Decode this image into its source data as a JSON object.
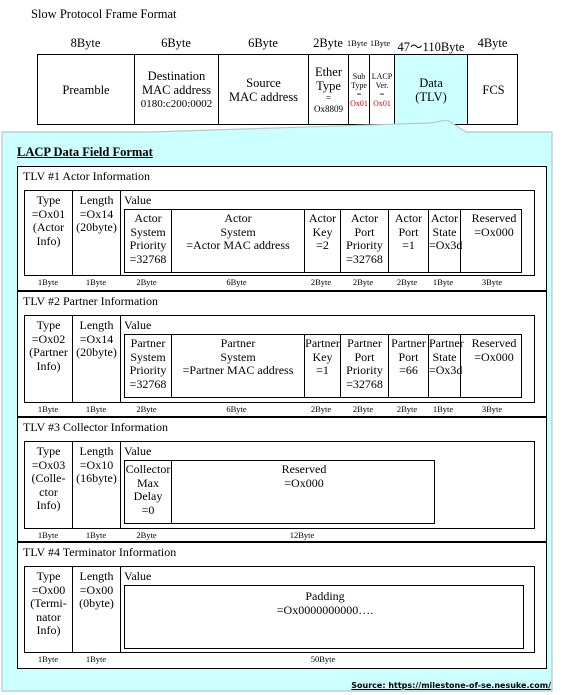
{
  "title": "Slow Protocol Frame  Format",
  "frame": {
    "fields": [
      {
        "size": "8Byte",
        "lines": [
          "Preamble"
        ]
      },
      {
        "size": "6Byte",
        "lines": [
          "Destination",
          "MAC address",
          "0180:c200:0002"
        ]
      },
      {
        "size": "6Byte",
        "lines": [
          "Source",
          "MAC address"
        ]
      },
      {
        "size": "2Byte",
        "lines": [
          "Ether",
          "Type",
          "=",
          "Ox8809"
        ]
      },
      {
        "size": "1Byte",
        "lines": [
          "Sub",
          "Type",
          "=",
          "Ox01"
        ]
      },
      {
        "size": "1Byte",
        "lines": [
          "LACP",
          "Ver.",
          "=",
          "Ox01"
        ]
      },
      {
        "size": "47〜110Byte",
        "lines": [
          "Data",
          "(TLV)"
        ]
      },
      {
        "size": "4Byte",
        "lines": [
          "FCS"
        ]
      }
    ],
    "highlight_color": "#ccffff",
    "value_color": "#e00000"
  },
  "lacp": {
    "title": "LACP  Data Field Format",
    "callout_color": "#ccffff",
    "value_label": "Value",
    "tlvs": [
      {
        "heading": "TLV #1 Actor Information",
        "type": [
          "Type",
          "=Ox01",
          "(Actor",
          "Info)"
        ],
        "length": [
          "Length",
          "=Ox14",
          "(20byte)"
        ],
        "values": [
          {
            "lines": [
              "Actor",
              "System",
              "Priority",
              "=32768"
            ],
            "size": "2Byte"
          },
          {
            "lines": [
              "Actor",
              "System",
              "=Actor MAC address"
            ],
            "size": "6Byte"
          },
          {
            "lines": [
              "Actor",
              "Key",
              "=2"
            ],
            "size": "2Byte"
          },
          {
            "lines": [
              "Actor",
              "Port",
              "Priority",
              "=32768"
            ],
            "size": "2Byte"
          },
          {
            "lines": [
              "Actor",
              "Port",
              "=1"
            ],
            "size": "2Byte"
          },
          {
            "lines": [
              "Actor",
              "State",
              "=Ox3d"
            ],
            "size": "1Byte"
          },
          {
            "lines": [
              "Reserved",
              "=Ox000"
            ],
            "size": "3Byte"
          }
        ],
        "type_size": "1Byte",
        "length_size": "1Byte"
      },
      {
        "heading": "TLV #2 Partner Information",
        "type": [
          "Type",
          "=Ox02",
          "(Partner",
          "Info)"
        ],
        "length": [
          "Length",
          "=Ox14",
          "(20byte)"
        ],
        "values": [
          {
            "lines": [
              "Partner",
              "System",
              "Priority",
              "=32768"
            ],
            "size": "2Byte"
          },
          {
            "lines": [
              "Partner",
              "System",
              "=Partner MAC address"
            ],
            "size": "6Byte"
          },
          {
            "lines": [
              "Partner",
              "Key",
              "=1"
            ],
            "size": "2Byte"
          },
          {
            "lines": [
              "Partner",
              "Port",
              "Priority",
              "=32768"
            ],
            "size": "2Byte"
          },
          {
            "lines": [
              "Partner",
              "Port",
              "=66"
            ],
            "size": "2Byte"
          },
          {
            "lines": [
              "Partner",
              "State",
              "=Ox3d"
            ],
            "size": "1Byte"
          },
          {
            "lines": [
              "Reserved",
              "=Ox000"
            ],
            "size": "3Byte"
          }
        ],
        "type_size": "1Byte",
        "length_size": "1Byte"
      },
      {
        "heading": "TLV #3 Collector Information",
        "type": [
          "Type",
          "=Ox03",
          "(Colle-",
          "ctor",
          "Info)"
        ],
        "length": [
          "Length",
          "=Ox10",
          "(16byte)"
        ],
        "values": [
          {
            "lines": [
              "Collector",
              "Max",
              "Delay",
              "=0"
            ],
            "size": "2Byte"
          },
          {
            "lines": [
              "Reserved",
              "=Ox000"
            ],
            "size": "12Byte"
          }
        ],
        "type_size": "1Byte",
        "length_size": "1Byte"
      },
      {
        "heading": "TLV #4 Terminator Information",
        "type": [
          "Type",
          "=Ox00",
          "(Termi-",
          "nator",
          "Info)"
        ],
        "length": [
          "Length",
          "=Ox00",
          "(0byte)"
        ],
        "values": [
          {
            "lines": [
              "Padding",
              "=Ox0000000000…."
            ],
            "size": "50Byte"
          }
        ],
        "type_size": "1Byte",
        "length_size": "1Byte"
      }
    ]
  },
  "source": "Source: https://milestone-of-se.nesuke.com/"
}
